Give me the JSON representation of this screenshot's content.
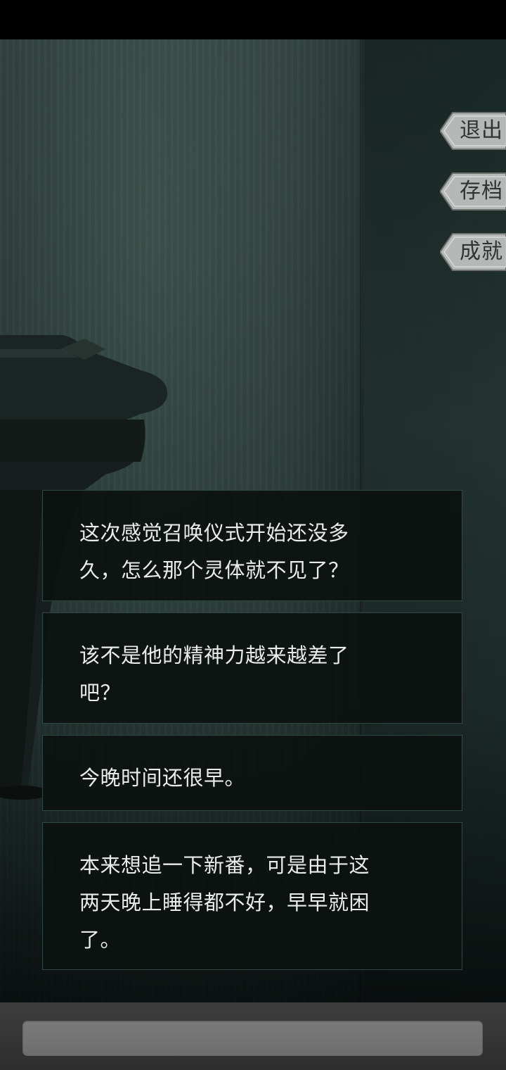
{
  "menu": {
    "exit_label": "退出",
    "save_label": "存档",
    "achievement_label": "成就"
  },
  "dialogs": [
    {
      "line1": "这次感觉召唤仪式开始还没多",
      "line2": "久，怎么那个灵体就不见了？"
    },
    {
      "line1": "该不是他的精神力越来越差了",
      "line2": "吧？"
    },
    {
      "line1": "今晚时间还很早。"
    },
    {
      "line1": "本来想追一下新番，可是由于这",
      "line2": "两天晚上睡得都不好，早早就困",
      "line3": "了。"
    }
  ],
  "colors": {
    "dialog_bg": "#0c1210",
    "dialog_border": "#2f4a44",
    "dialog_text": "#e9ecea",
    "menu_button": "#b5b8b6"
  }
}
